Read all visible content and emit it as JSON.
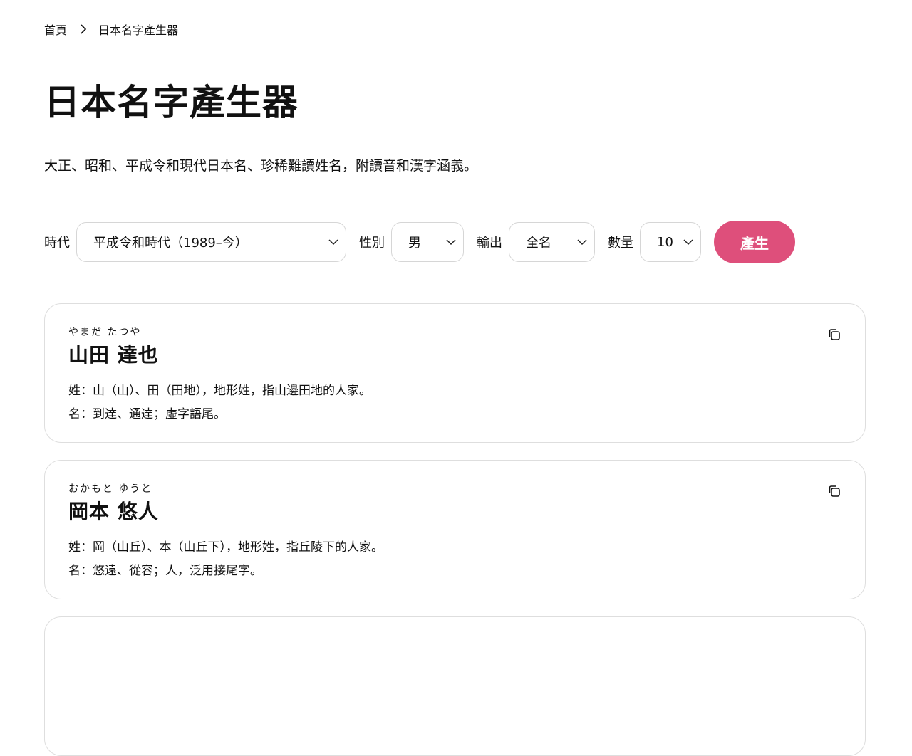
{
  "breadcrumb": {
    "home": "首頁",
    "current": "日本名字產生器"
  },
  "page_title": "日本名字產生器",
  "subtitle": "大正、昭和、平成令和現代日本名、珍稀難讀姓名，附讀音和漢字涵義。",
  "controls": {
    "era_label": "時代",
    "era_value": "平成令和時代（1989–今）",
    "gender_label": "性別",
    "gender_value": "男",
    "output_label": "輸出",
    "output_value": "全名",
    "count_label": "數量",
    "count_value": "10",
    "generate_label": "產生"
  },
  "colors": {
    "accent": "#de4f7b"
  },
  "results": [
    {
      "reading": "やまだ たつや",
      "name": "山田 達也",
      "surname_note": "姓：山（山）、田（田地），地形姓，指山邊田地的人家。",
      "given_note": "名：到達、通達；虛字語尾。"
    },
    {
      "reading": "おかもと ゆうと",
      "name": "岡本 悠人",
      "surname_note": "姓：岡（山丘）、本（山丘下），地形姓，指丘陵下的人家。",
      "given_note": "名：悠遠、從容；人，泛用接尾字。"
    }
  ],
  "icons": {
    "copy": "copy-icon",
    "chevron": "chevron-down-icon",
    "breadcrumb_separator": "chevron-right-icon"
  }
}
